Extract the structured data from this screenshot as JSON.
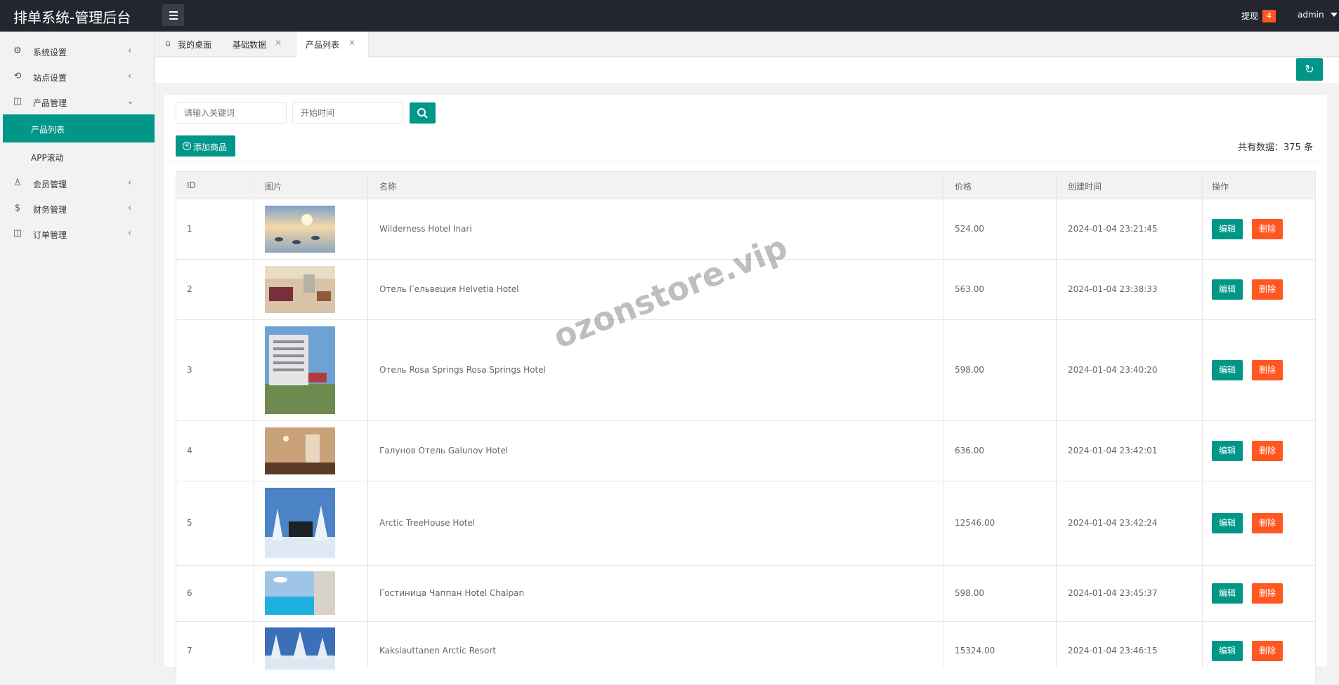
{
  "header": {
    "title": "排单系统-管理后台",
    "withdraw_label": "提现",
    "withdraw_count": "4",
    "user": "admin"
  },
  "sidebar": {
    "items": [
      {
        "label": "系统设置",
        "icon": "gear-icon"
      },
      {
        "label": "站点设置",
        "icon": "site-icon"
      },
      {
        "label": "产品管理",
        "icon": "box-icon"
      },
      {
        "label": "会员管理",
        "icon": "user-icon"
      },
      {
        "label": "财务管理",
        "icon": "dollar-icon"
      },
      {
        "label": "订单管理",
        "icon": "order-icon"
      }
    ],
    "sub_items": [
      {
        "label": "产品列表"
      },
      {
        "label": "APP滚动"
      }
    ]
  },
  "tabs": [
    {
      "label": "我的桌面"
    },
    {
      "label": "基础数据"
    },
    {
      "label": "产品列表"
    }
  ],
  "toolbar": {
    "keyword_placeholder": "请输入关键词",
    "date_placeholder": "开始时间",
    "add_label": "添加商品",
    "total_text": "共有数据：375 条"
  },
  "table": {
    "headers": [
      "ID",
      "图片",
      "名称",
      "价格",
      "创建时间",
      "操作"
    ],
    "edit_label": "编辑",
    "delete_label": "删除",
    "rows": [
      {
        "id": "1",
        "name": "Wilderness Hotel Inari",
        "price": "524.00",
        "created": "2024-01-04 23:21:45"
      },
      {
        "id": "2",
        "name": "Отель Гельвеция Helvetia Hotel",
        "price": "563.00",
        "created": "2024-01-04 23:38:33"
      },
      {
        "id": "3",
        "name": "Отель Rosa Springs Rosa Springs Hotel",
        "price": "598.00",
        "created": "2024-01-04 23:40:20"
      },
      {
        "id": "4",
        "name": "Галунов Отель Galunov Hotel",
        "price": "636.00",
        "created": "2024-01-04 23:42:01"
      },
      {
        "id": "5",
        "name": "Arctic TreeHouse Hotel",
        "price": "12546.00",
        "created": "2024-01-04 23:42:24"
      },
      {
        "id": "6",
        "name": "Гостиница Чаппан Hotel Chalpan",
        "price": "598.00",
        "created": "2024-01-04 23:45:37"
      },
      {
        "id": "7",
        "name": "Kakslauttanen Arctic Resort",
        "price": "15324.00",
        "created": "2024-01-04 23:46:15"
      }
    ]
  },
  "watermark": "ozonstore.vip",
  "colors": {
    "primary": "#009688",
    "danger": "#ff5722",
    "topbar": "#23262e"
  }
}
